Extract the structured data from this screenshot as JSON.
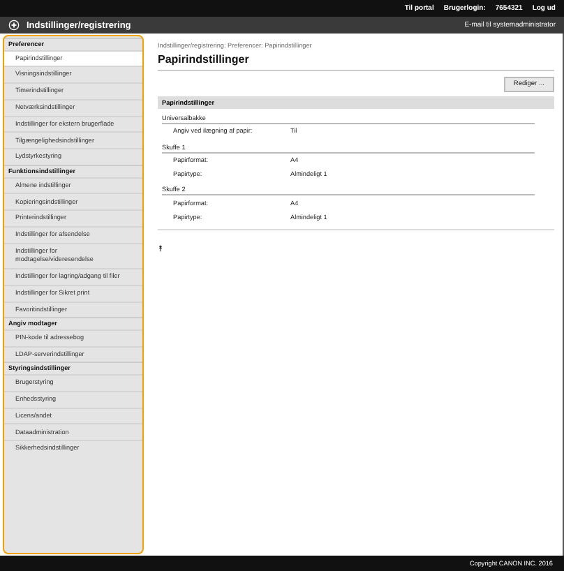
{
  "top_bar": {
    "portal_link": "Til portal",
    "login_label": "Brugerlogin:",
    "user": "7654321",
    "logout": "Log ud"
  },
  "header": {
    "title": "Indstillinger/registrering",
    "admin_mail": "E-mail til systemadministrator"
  },
  "sidebar": {
    "sections": [
      {
        "title": "Preferencer",
        "items": [
          {
            "label": "Papirindstillinger",
            "selected": true
          },
          {
            "label": "Visningsindstillinger",
            "selected": false
          },
          {
            "label": "Timerindstillinger",
            "selected": false
          },
          {
            "label": "Netværksindstillinger",
            "selected": false
          },
          {
            "label": "Indstillinger for ekstern brugerflade",
            "selected": false
          },
          {
            "label": "Tilgængelighedsindstillinger",
            "selected": false
          },
          {
            "label": "Lydstyrkestyring",
            "selected": false
          }
        ]
      },
      {
        "title": "Funktionsindstillinger",
        "items": [
          {
            "label": "Almene indstillinger",
            "selected": false
          },
          {
            "label": "Kopieringsindstillinger",
            "selected": false
          },
          {
            "label": "Printerindstillinger",
            "selected": false
          },
          {
            "label": "Indstillinger for afsendelse",
            "selected": false
          },
          {
            "label": "Indstillinger for modtagelse/videresendelse",
            "selected": false
          },
          {
            "label": "Indstillinger for lagring/adgang til filer",
            "selected": false
          },
          {
            "label": "Indstillinger for Sikret print",
            "selected": false
          },
          {
            "label": "Favoritindstillinger",
            "selected": false
          }
        ]
      },
      {
        "title": "Angiv modtager",
        "items": [
          {
            "label": "PIN-kode til adressebog",
            "selected": false
          },
          {
            "label": "LDAP-serverindstillinger",
            "selected": false
          }
        ]
      },
      {
        "title": "Styringsindstillinger",
        "items": [
          {
            "label": "Brugerstyring",
            "selected": false
          },
          {
            "label": "Enhedsstyring",
            "selected": false
          },
          {
            "label": "Licens/andet",
            "selected": false
          },
          {
            "label": "Dataadministration",
            "selected": false
          },
          {
            "label": "Sikkerhedsindstillinger",
            "selected": false
          }
        ]
      }
    ]
  },
  "main": {
    "breadcrumb": "Indstillinger/registrering: Preferencer: Papirindstillinger",
    "title": "Papirindstillinger",
    "edit_button": "Rediger ...",
    "section_title": "Papirindstillinger",
    "groups": [
      {
        "title": "Universalbakke",
        "rows": [
          {
            "label": "Angiv ved ilægning af papir:",
            "value": "Til"
          }
        ]
      },
      {
        "title": "Skuffe 1",
        "rows": [
          {
            "label": "Papirformat:",
            "value": "A4"
          },
          {
            "label": "Papirtype:",
            "value": "Almindeligt 1"
          }
        ]
      },
      {
        "title": "Skuffe 2",
        "rows": [
          {
            "label": "Papirformat:",
            "value": "A4"
          },
          {
            "label": "Papirtype:",
            "value": "Almindeligt 1"
          }
        ]
      }
    ],
    "top_link": "⯭"
  },
  "footer": {
    "copyright": "Copyright CANON INC. 2016"
  }
}
